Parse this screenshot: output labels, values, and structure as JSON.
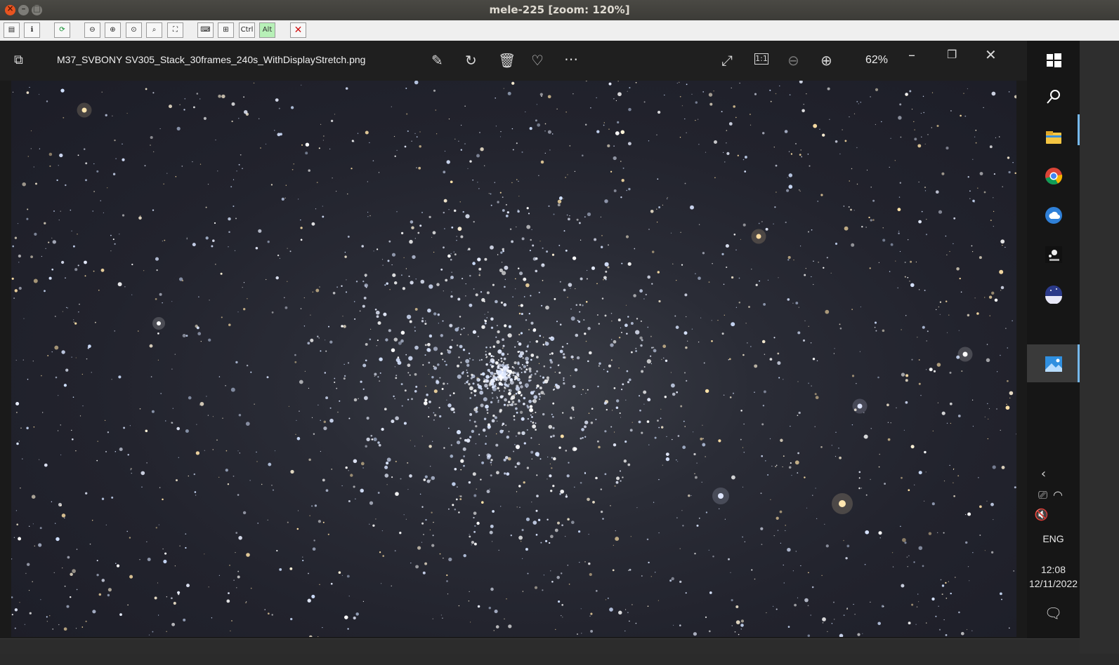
{
  "window": {
    "title": "mele-225 [zoom: 120%]"
  },
  "vnc_toolbar": {
    "ctrl_label": "Ctrl",
    "alt_label": "Alt"
  },
  "photos_app": {
    "file_name": "M37_SVBONY SV305_Stack_30frames_240s_WithDisplayStretch.png",
    "zoom_level": "62%",
    "actual_size_label": "1:1"
  },
  "taskbar": {
    "language": "ENG",
    "time": "12:08",
    "date": "12/11/2022"
  },
  "colors": {
    "accent": "#76b9ed",
    "ubuntu_close": "#e95420"
  }
}
